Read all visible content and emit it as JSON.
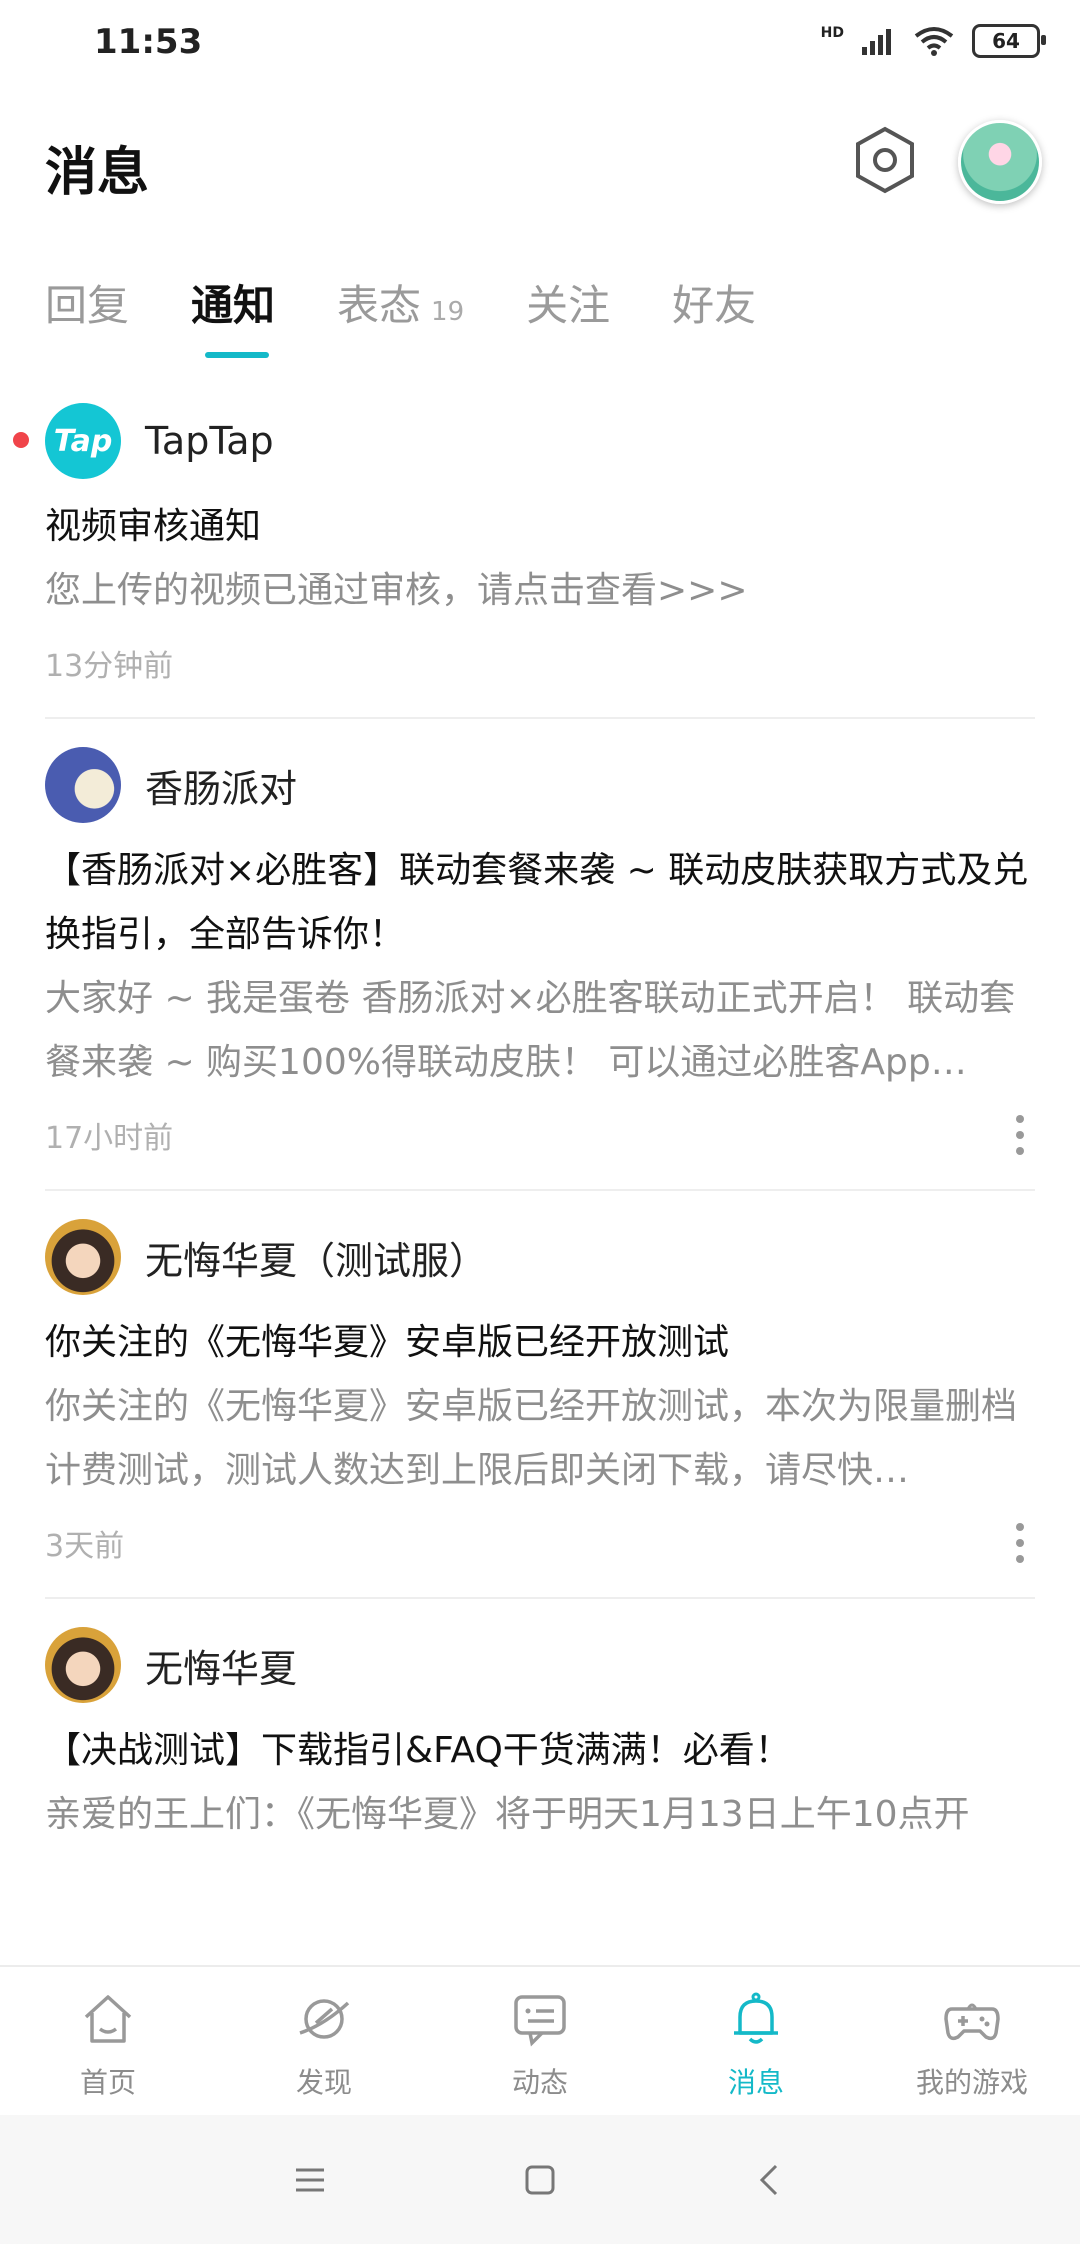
{
  "status_bar": {
    "time": "11:53",
    "battery": "64",
    "network": "HD"
  },
  "header": {
    "title": "消息"
  },
  "tabs": [
    {
      "label": "回复"
    },
    {
      "label": "通知"
    },
    {
      "label": "表态",
      "count": "19"
    },
    {
      "label": "关注"
    },
    {
      "label": "好友"
    }
  ],
  "feed": [
    {
      "sender": "TapTap",
      "avatar_text": "Tap",
      "title": "视频审核通知",
      "body": "您上传的视频已通过审核，请点击查看>>>",
      "time": "13分钟前"
    },
    {
      "sender": "香肠派对",
      "title": "【香肠派对×必胜客】联动套餐来袭 ~ 联动皮肤获取方式及兑换指引，全部告诉你！",
      "body": "大家好 ~ 我是蛋卷 香肠派对×必胜客联动正式开启！ 联动套餐来袭 ~ 购买100%得联动皮肤！ 可以通过必胜客App…",
      "time": "17小时前"
    },
    {
      "sender": "无悔华夏（测试服）",
      "title": "你关注的《无悔华夏》安卓版已经开放测试",
      "body": "你关注的《无悔华夏》安卓版已经开放测试，本次为限量删档计费测试，测试人数达到上限后即关闭下载，请尽快…",
      "time": "3天前"
    },
    {
      "sender": "无悔华夏",
      "title": "【决战测试】下载指引&FAQ干货满满！必看！",
      "body": "亲爱的王上们：《无悔华夏》将于明天1月13日上午10点开"
    }
  ],
  "bottom_nav": [
    {
      "label": "首页",
      "icon": "home-icon"
    },
    {
      "label": "发现",
      "icon": "planet-icon"
    },
    {
      "label": "动态",
      "icon": "chat-icon"
    },
    {
      "label": "消息",
      "icon": "bell-icon"
    },
    {
      "label": "我的游戏",
      "icon": "gamepad-icon"
    }
  ],
  "colors": {
    "accent": "#14b9c8",
    "unread": "#f0444a"
  }
}
